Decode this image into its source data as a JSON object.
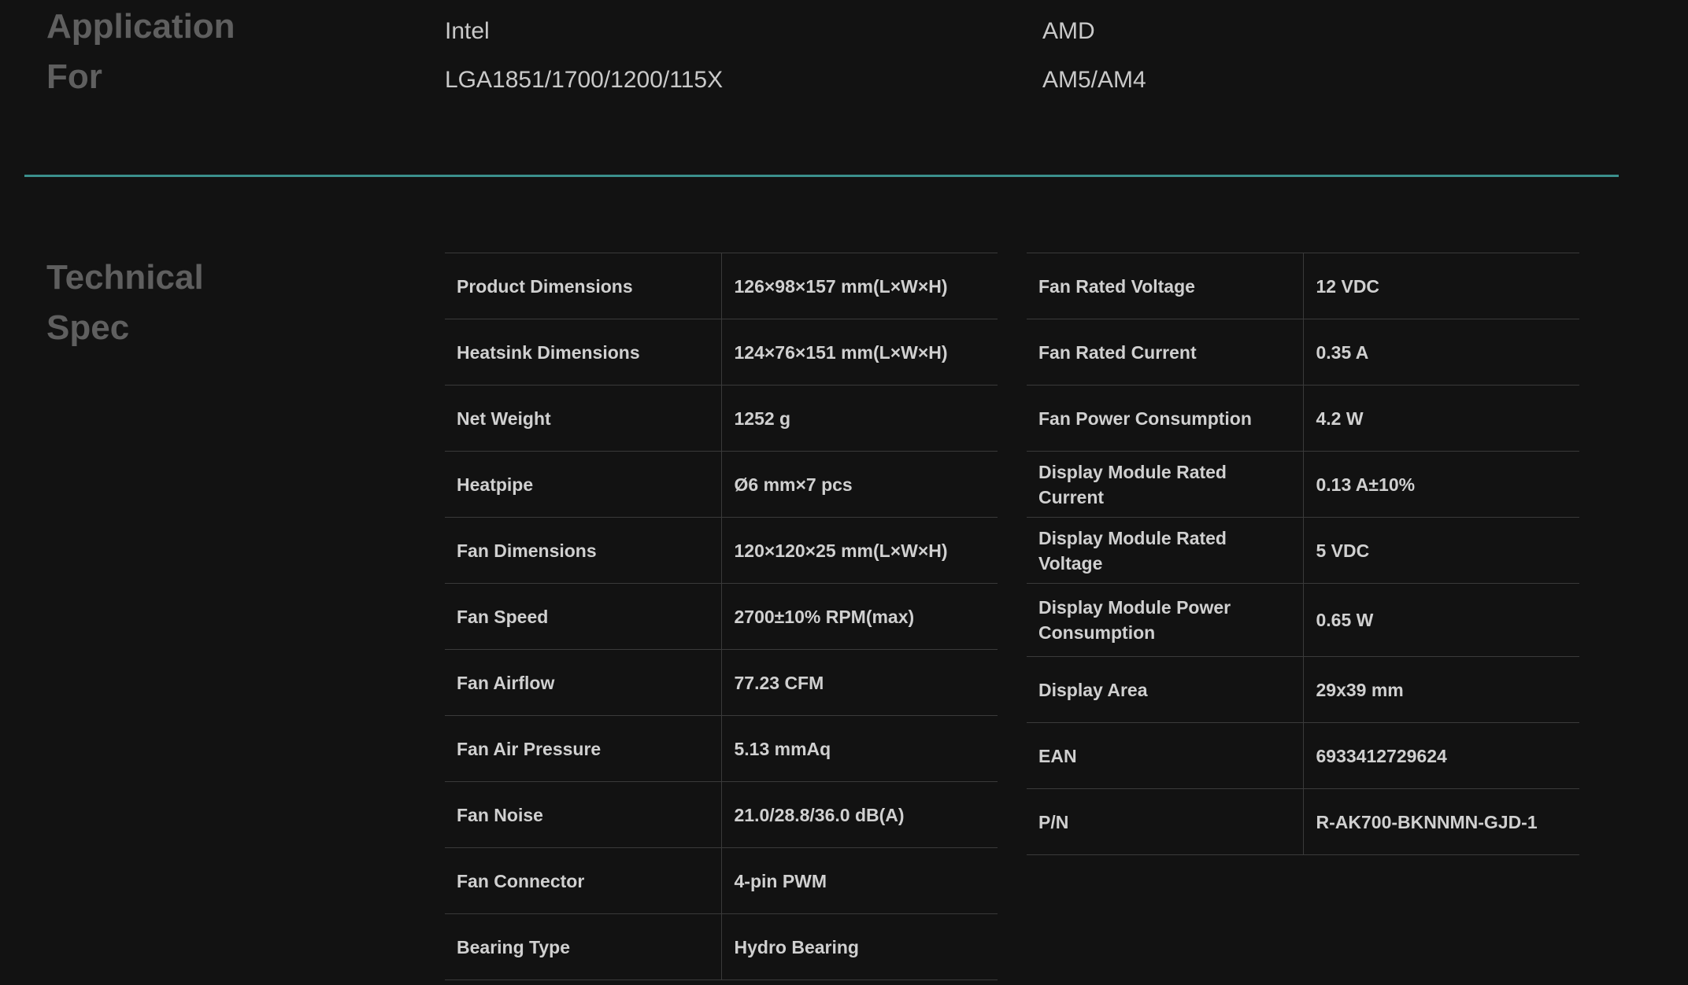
{
  "application": {
    "title_line1": "Application",
    "title_line2": "For",
    "intel": {
      "label": "Intel",
      "sockets": "LGA1851/1700/1200/115X"
    },
    "amd": {
      "label": "AMD",
      "sockets": "AM5/AM4"
    }
  },
  "technical": {
    "title_line1": "Technical",
    "title_line2": "Spec",
    "left": [
      {
        "k": "Product Dimensions",
        "v": "126×98×157 mm(L×W×H)"
      },
      {
        "k": "Heatsink Dimensions",
        "v": "124×76×151 mm(L×W×H)"
      },
      {
        "k": "Net Weight",
        "v": "1252 g"
      },
      {
        "k": "Heatpipe",
        "v": "Ø6 mm×7 pcs"
      },
      {
        "k": "Fan Dimensions",
        "v": "120×120×25 mm(L×W×H)"
      },
      {
        "k": "Fan Speed",
        "v": "2700±10% RPM(max)"
      },
      {
        "k": "Fan Airflow",
        "v": "77.23 CFM"
      },
      {
        "k": "Fan Air Pressure",
        "v": "5.13 mmAq"
      },
      {
        "k": "Fan Noise",
        "v": "21.0/28.8/36.0 dB(A)"
      },
      {
        "k": "Fan Connector",
        "v": "4-pin PWM"
      },
      {
        "k": "Bearing Type",
        "v": "Hydro Bearing"
      }
    ],
    "right": [
      {
        "k": "Fan Rated Voltage",
        "v": "12 VDC"
      },
      {
        "k": "Fan Rated Current",
        "v": "0.35 A"
      },
      {
        "k": "Fan Power Consumption",
        "v": "4.2 W"
      },
      {
        "k": "Display Module Rated Current",
        "v": "0.13 A±10%"
      },
      {
        "k": "Display Module Rated Voltage",
        "v": "5 VDC"
      },
      {
        "k": "Display Module Power Consumption",
        "v": "0.65 W"
      },
      {
        "k": "Display Area",
        "v": "29x39 mm"
      },
      {
        "k": "EAN",
        "v": "6933412729624"
      },
      {
        "k": "P/N",
        "v": "R-AK700-BKNNMN-GJD-1"
      }
    ]
  }
}
